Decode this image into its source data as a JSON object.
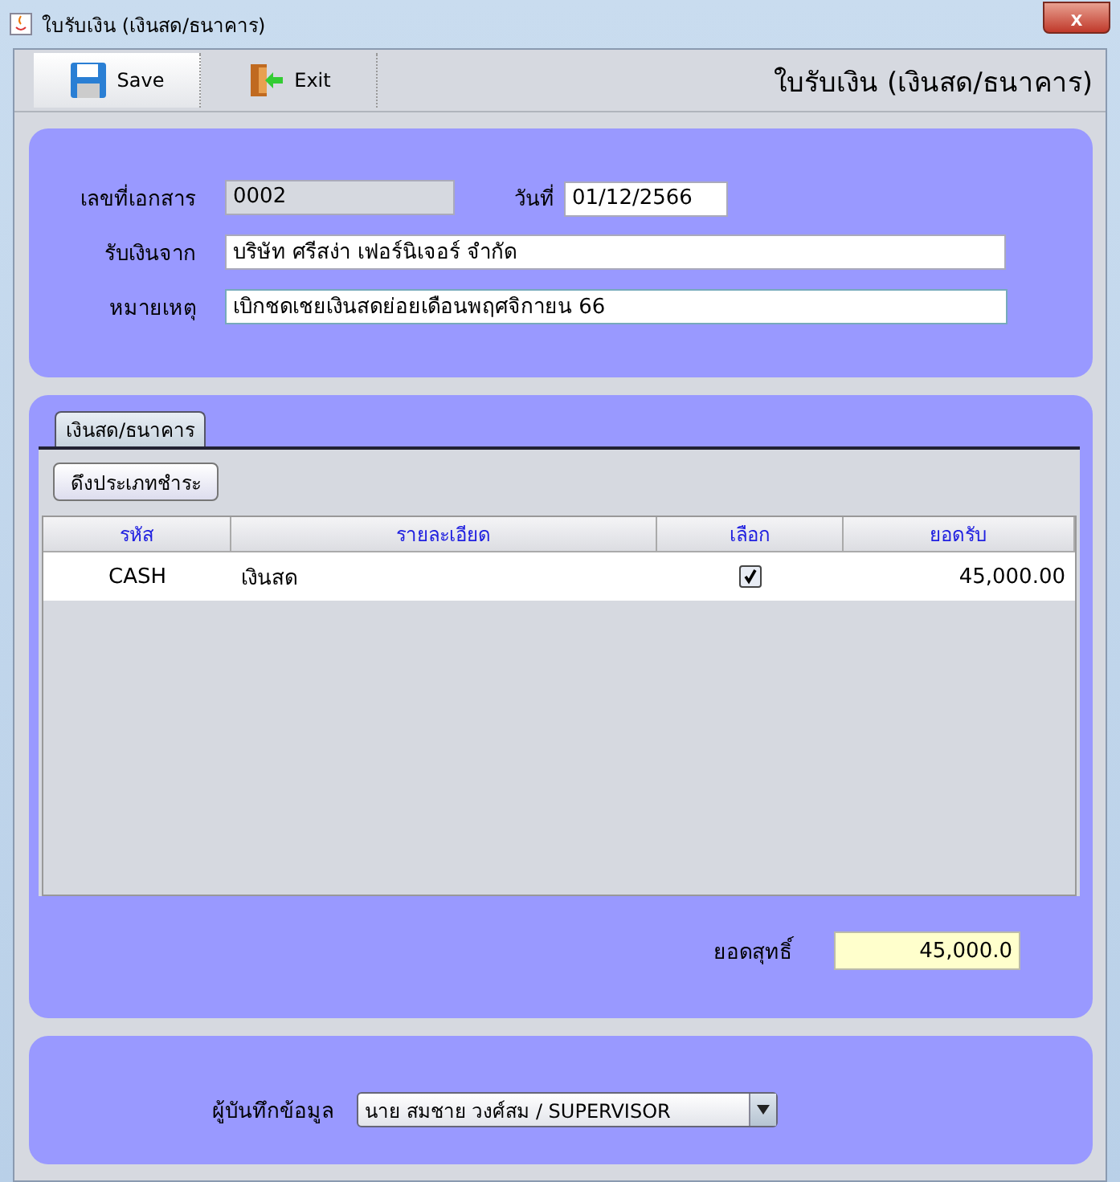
{
  "window": {
    "title": "ใบรับเงิน (เงินสด/ธนาคาร)",
    "close": "x"
  },
  "toolbar": {
    "buttons": [
      {
        "label": "Save",
        "kind": "save"
      },
      {
        "label": "Exit",
        "kind": "exit"
      }
    ],
    "heading": "ใบรับเงิน (เงินสด/ธนาคาร)"
  },
  "header": {
    "doc_no_label": "เลขที่เอกสาร",
    "doc_no": "0002",
    "date_label": "วันที่",
    "date": "01/12/2566",
    "from_label": "รับเงินจาก",
    "from": "บริษัท ศรีสง่า เฟอร์นิเจอร์ จำกัด",
    "note_label": "หมายเหตุ",
    "note": "เบิกชดเชยเงินสดย่อยเดือนพฤศจิกายน 66"
  },
  "tabs": [
    {
      "label": "เงินสด/ธนาคาร",
      "selected": true
    }
  ],
  "fetch_button": "ดึงประเภทชำระ",
  "table": {
    "columns": [
      "รหัส",
      "รายละเอียด",
      "เลือก",
      "ยอดรับ"
    ],
    "rows": [
      {
        "code": "CASH",
        "detail": "เงินสด",
        "checked": true,
        "amount": "45,000.00"
      }
    ]
  },
  "net": {
    "label": "ยอดสุทธิ์",
    "value": "45,000.0"
  },
  "recorder": {
    "label": "ผู้บันทึกข้อมูล",
    "value": "นาย สมชาย วงศ์สม / SUPERVISOR"
  }
}
